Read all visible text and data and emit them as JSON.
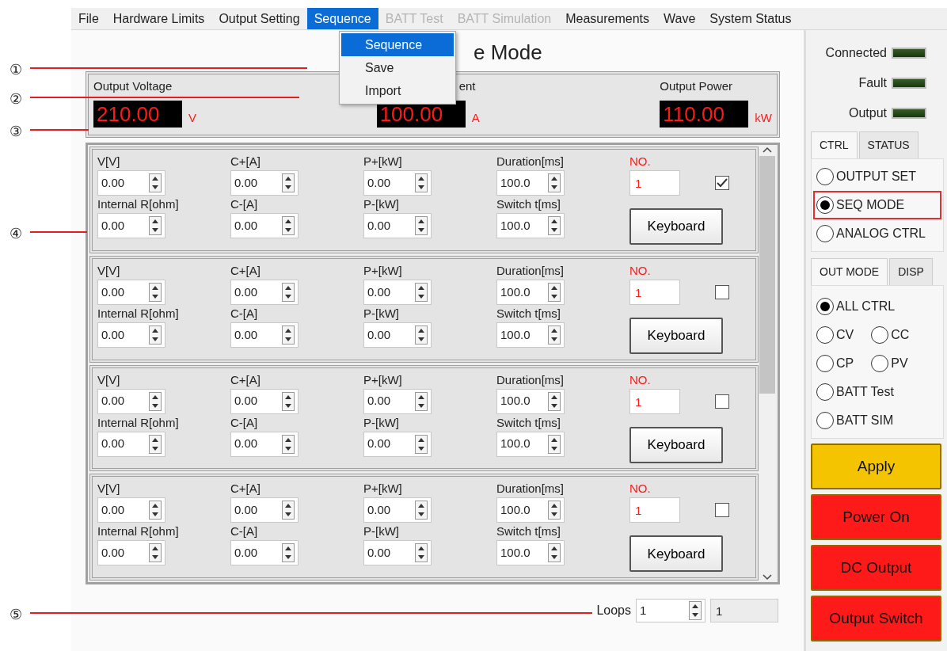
{
  "menu": [
    {
      "label": "File",
      "selected": false,
      "disabled": false
    },
    {
      "label": "Hardware Limits",
      "selected": false,
      "disabled": false
    },
    {
      "label": "Output Setting",
      "selected": false,
      "disabled": false
    },
    {
      "label": "Sequence",
      "selected": true,
      "disabled": false
    },
    {
      "label": "BATT Test",
      "selected": false,
      "disabled": true
    },
    {
      "label": "BATT Simulation",
      "selected": false,
      "disabled": true
    },
    {
      "label": "Measurements",
      "selected": false,
      "disabled": false
    },
    {
      "label": "Wave",
      "selected": false,
      "disabled": false
    },
    {
      "label": "System Status",
      "selected": false,
      "disabled": false
    }
  ],
  "dropdown": [
    {
      "label": "Sequence",
      "selected": true
    },
    {
      "label": "Save",
      "selected": false
    },
    {
      "label": "Import",
      "selected": false
    }
  ],
  "title": "e Mode",
  "readouts": [
    {
      "label": "Output Voltage",
      "value": "210.00",
      "unit": "V"
    },
    {
      "label": "ent",
      "value": "100.00",
      "unit": "A"
    },
    {
      "label": "Output Power",
      "value": "110.00",
      "unit": "kW"
    }
  ],
  "sequence_rows": [
    {
      "fields": [
        {
          "label": "V[V]",
          "value": "0.00"
        },
        {
          "label": "C+[A]",
          "value": "0.00"
        },
        {
          "label": "P+[kW]",
          "value": "0.00"
        },
        {
          "label": "Duration[ms]",
          "value": "100.0"
        },
        {
          "label": "Internal R[ohm]",
          "value": "0.00"
        },
        {
          "label": "C-[A]",
          "value": "0.00"
        },
        {
          "label": "P-[kW]",
          "value": "0.00"
        },
        {
          "label": "Switch t[ms]",
          "value": "100.0"
        }
      ],
      "no_label": "NO.",
      "no": "1",
      "checked": true,
      "button": "Keyboard"
    },
    {
      "fields": [
        {
          "label": "V[V]",
          "value": "0.00"
        },
        {
          "label": "C+[A]",
          "value": "0.00"
        },
        {
          "label": "P+[kW]",
          "value": "0.00"
        },
        {
          "label": "Duration[ms]",
          "value": "100.0"
        },
        {
          "label": "Internal R[ohm]",
          "value": "0.00"
        },
        {
          "label": "C-[A]",
          "value": "0.00"
        },
        {
          "label": "P-[kW]",
          "value": "0.00"
        },
        {
          "label": "Switch t[ms]",
          "value": "100.0"
        }
      ],
      "no_label": "NO.",
      "no": "1",
      "checked": false,
      "button": "Keyboard"
    },
    {
      "fields": [
        {
          "label": "V[V]",
          "value": "0.00"
        },
        {
          "label": "C+[A]",
          "value": "0.00"
        },
        {
          "label": "P+[kW]",
          "value": "0.00"
        },
        {
          "label": "Duration[ms]",
          "value": "100.0"
        },
        {
          "label": "Internal R[ohm]",
          "value": "0.00"
        },
        {
          "label": "C-[A]",
          "value": "0.00"
        },
        {
          "label": "P-[kW]",
          "value": "0.00"
        },
        {
          "label": "Switch t[ms]",
          "value": "100.0"
        }
      ],
      "no_label": "NO.",
      "no": "1",
      "checked": false,
      "button": "Keyboard"
    },
    {
      "fields": [
        {
          "label": "V[V]",
          "value": "0.00"
        },
        {
          "label": "C+[A]",
          "value": "0.00"
        },
        {
          "label": "P+[kW]",
          "value": "0.00"
        },
        {
          "label": "Duration[ms]",
          "value": "100.0"
        },
        {
          "label": "Internal R[ohm]",
          "value": "0.00"
        },
        {
          "label": "C-[A]",
          "value": "0.00"
        },
        {
          "label": "P-[kW]",
          "value": "0.00"
        },
        {
          "label": "Switch t[ms]",
          "value": "100.0"
        }
      ],
      "no_label": "NO.",
      "no": "1",
      "checked": false,
      "button": "Keyboard"
    }
  ],
  "loops": {
    "label": "Loops",
    "value": "1",
    "display": "1"
  },
  "indicators": [
    {
      "label": "Connected",
      "on": false
    },
    {
      "label": "Fault",
      "on": false
    },
    {
      "label": "Output",
      "on": false
    }
  ],
  "ctrl_tabs": [
    {
      "label": "CTRL",
      "selected": true
    },
    {
      "label": "STATUS",
      "selected": false
    }
  ],
  "ctrl_options": [
    {
      "label": "OUTPUT SET",
      "selected": false,
      "highlighted": false
    },
    {
      "label": "SEQ MODE",
      "selected": true,
      "highlighted": true
    },
    {
      "label": "ANALOG CTRL",
      "selected": false,
      "highlighted": false
    }
  ],
  "mode_tabs": [
    {
      "label": "OUT MODE",
      "selected": true
    },
    {
      "label": "DISP",
      "selected": false
    }
  ],
  "mode_options": [
    [
      {
        "label": "ALL CTRL",
        "selected": true
      }
    ],
    [
      {
        "label": "CV",
        "selected": false
      },
      {
        "label": "CC",
        "selected": false
      }
    ],
    [
      {
        "label": "CP",
        "selected": false
      },
      {
        "label": "PV",
        "selected": false
      }
    ],
    [
      {
        "label": "BATT Test",
        "selected": false
      }
    ],
    [
      {
        "label": "BATT SIM",
        "selected": false
      }
    ]
  ],
  "action_buttons": [
    {
      "label": "Apply",
      "color": "#f5c400"
    },
    {
      "label": "Power On",
      "color": "#ff1a1a"
    },
    {
      "label": "DC Output",
      "color": "#ff1a1a"
    },
    {
      "label": "Output Switch",
      "color": "#ff1a1a"
    }
  ],
  "annotations": [
    "①",
    "②",
    "③",
    "④",
    "⑤"
  ]
}
